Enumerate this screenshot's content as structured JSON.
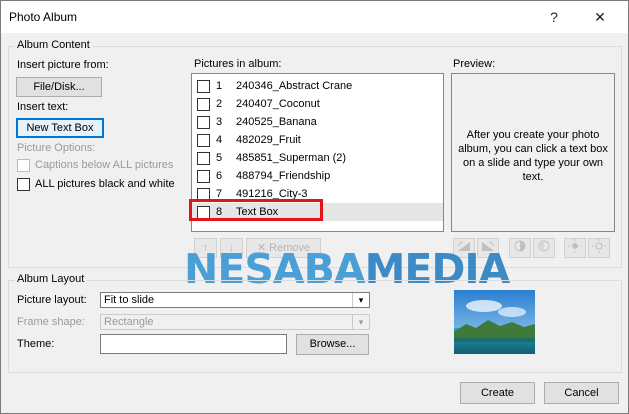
{
  "window": {
    "title": "Photo Album",
    "help_glyph": "?",
    "close_glyph": "✕"
  },
  "album_content": {
    "group_label": "Album Content",
    "insert_picture_label": "Insert picture from:",
    "file_disk_button": "File/Disk...",
    "insert_text_label": "Insert text:",
    "new_text_box_button": "New Text Box",
    "picture_options_label": "Picture Options:",
    "captions_option": "Captions below ALL pictures",
    "black_white_option": "ALL pictures black and white",
    "pictures_in_album_label": "Pictures in album:",
    "pictures": [
      {
        "num": "1",
        "name": "240346_Abstract Crane"
      },
      {
        "num": "2",
        "name": "240407_Coconut"
      },
      {
        "num": "3",
        "name": "240525_Banana"
      },
      {
        "num": "4",
        "name": "482029_Fruit"
      },
      {
        "num": "5",
        "name": "485851_Superman (2)"
      },
      {
        "num": "6",
        "name": "488794_Friendship"
      },
      {
        "num": "7",
        "name": "491216_City-3"
      },
      {
        "num": "8",
        "name": "Text Box"
      }
    ],
    "move_up_glyph": "↑",
    "move_down_glyph": "↓",
    "remove_glyph": "✕",
    "remove_label": "Remove",
    "preview_label": "Preview:",
    "preview_text": "After you create your photo album, you can click a text box on a slide and type your own text.",
    "rotate_icons": [
      "rotate-left-icon",
      "rotate-right-icon",
      "contrast-up-icon",
      "contrast-down-icon",
      "brightness-up-icon",
      "brightness-down-icon"
    ]
  },
  "album_layout": {
    "group_label": "Album Layout",
    "picture_layout_label": "Picture layout:",
    "picture_layout_value": "Fit to slide",
    "frame_shape_label": "Frame shape:",
    "frame_shape_value": "Rectangle",
    "theme_label": "Theme:",
    "theme_value": "",
    "browse_button": "Browse..."
  },
  "footer": {
    "create_button": "Create",
    "cancel_button": "Cancel"
  },
  "watermark": {
    "part1": "NESABA",
    "part2": "MEDIA"
  },
  "colors": {
    "accent": "#0078d7",
    "highlight_box": "#e3151a"
  }
}
